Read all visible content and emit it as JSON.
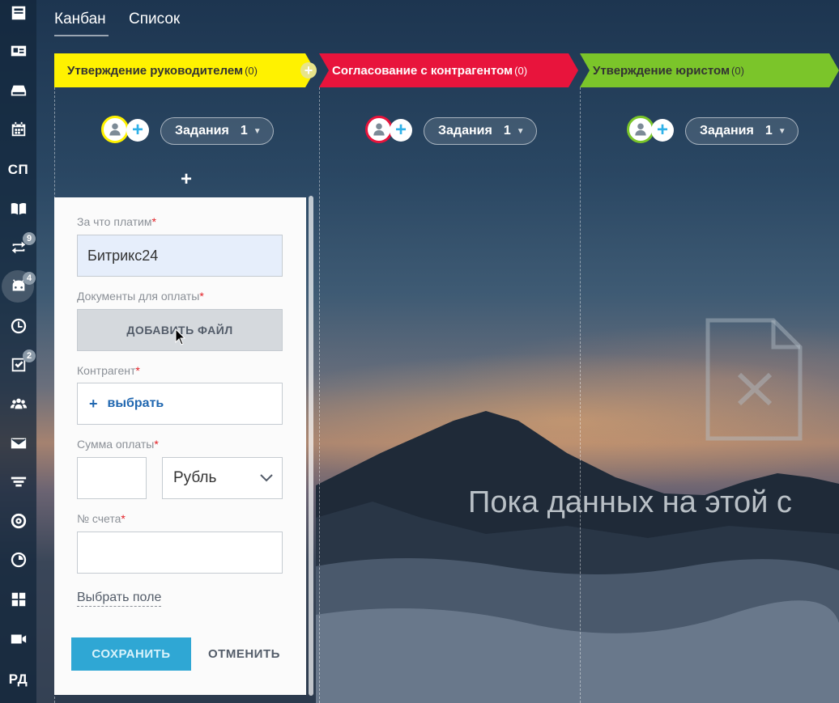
{
  "sidebar": {
    "items": [
      {
        "icon": "feed-icon"
      },
      {
        "icon": "contact-card-icon"
      },
      {
        "icon": "drive-icon"
      },
      {
        "icon": "calendar-icon"
      },
      {
        "text": "СП"
      },
      {
        "icon": "knowledge-book-icon"
      },
      {
        "icon": "sync-icon",
        "badge": "9"
      },
      {
        "icon": "robot-icon",
        "badge": "4",
        "active": true
      },
      {
        "icon": "clock-icon"
      },
      {
        "icon": "tasks-icon",
        "badge": "2"
      },
      {
        "icon": "users-icon"
      },
      {
        "icon": "mail-icon"
      },
      {
        "icon": "funnel-icon"
      },
      {
        "icon": "target-icon"
      },
      {
        "icon": "timeman-icon"
      },
      {
        "icon": "apps-icon"
      },
      {
        "icon": "video-icon"
      },
      {
        "text": "РД"
      }
    ]
  },
  "tabs": [
    {
      "label": "Канбан",
      "active": true
    },
    {
      "label": "Список",
      "active": false
    }
  ],
  "stages": [
    {
      "title": "Утверждение руководителем",
      "count": "(0)",
      "color": "#fff200",
      "tasks_label": "Задания",
      "tasks_count": "1"
    },
    {
      "title": "Согласование с контрагентом",
      "count": "(0)",
      "color": "#e8143c",
      "tasks_label": "Задания",
      "tasks_count": "1"
    },
    {
      "title": "Утверждение юристом",
      "count": "(0)",
      "color": "#7bc52a",
      "tasks_label": "Задания",
      "tasks_count": "1"
    }
  ],
  "form": {
    "pay_for_label": "За что платим",
    "pay_for_value": "Битрикс24",
    "documents_label": "Документы для оплаты",
    "add_file_label": "ДОБАВИТЬ ФАЙЛ",
    "counterparty_label": "Контрагент",
    "select_label": "выбрать",
    "amount_label": "Сумма оплаты",
    "amount_value": "",
    "currency_value": "Рубль",
    "invoice_label": "№ счета",
    "invoice_value": "",
    "required_mark": "*",
    "choose_field_label": "Выбрать поле",
    "save_label": "СОХРАНИТЬ",
    "cancel_label": "ОТМЕНИТЬ"
  },
  "empty_state": {
    "text": "Пока данных на этой с"
  },
  "colors": {
    "accent_blue": "#2fa7d4",
    "link_blue": "#2067b0",
    "required_red": "#e21e24"
  }
}
